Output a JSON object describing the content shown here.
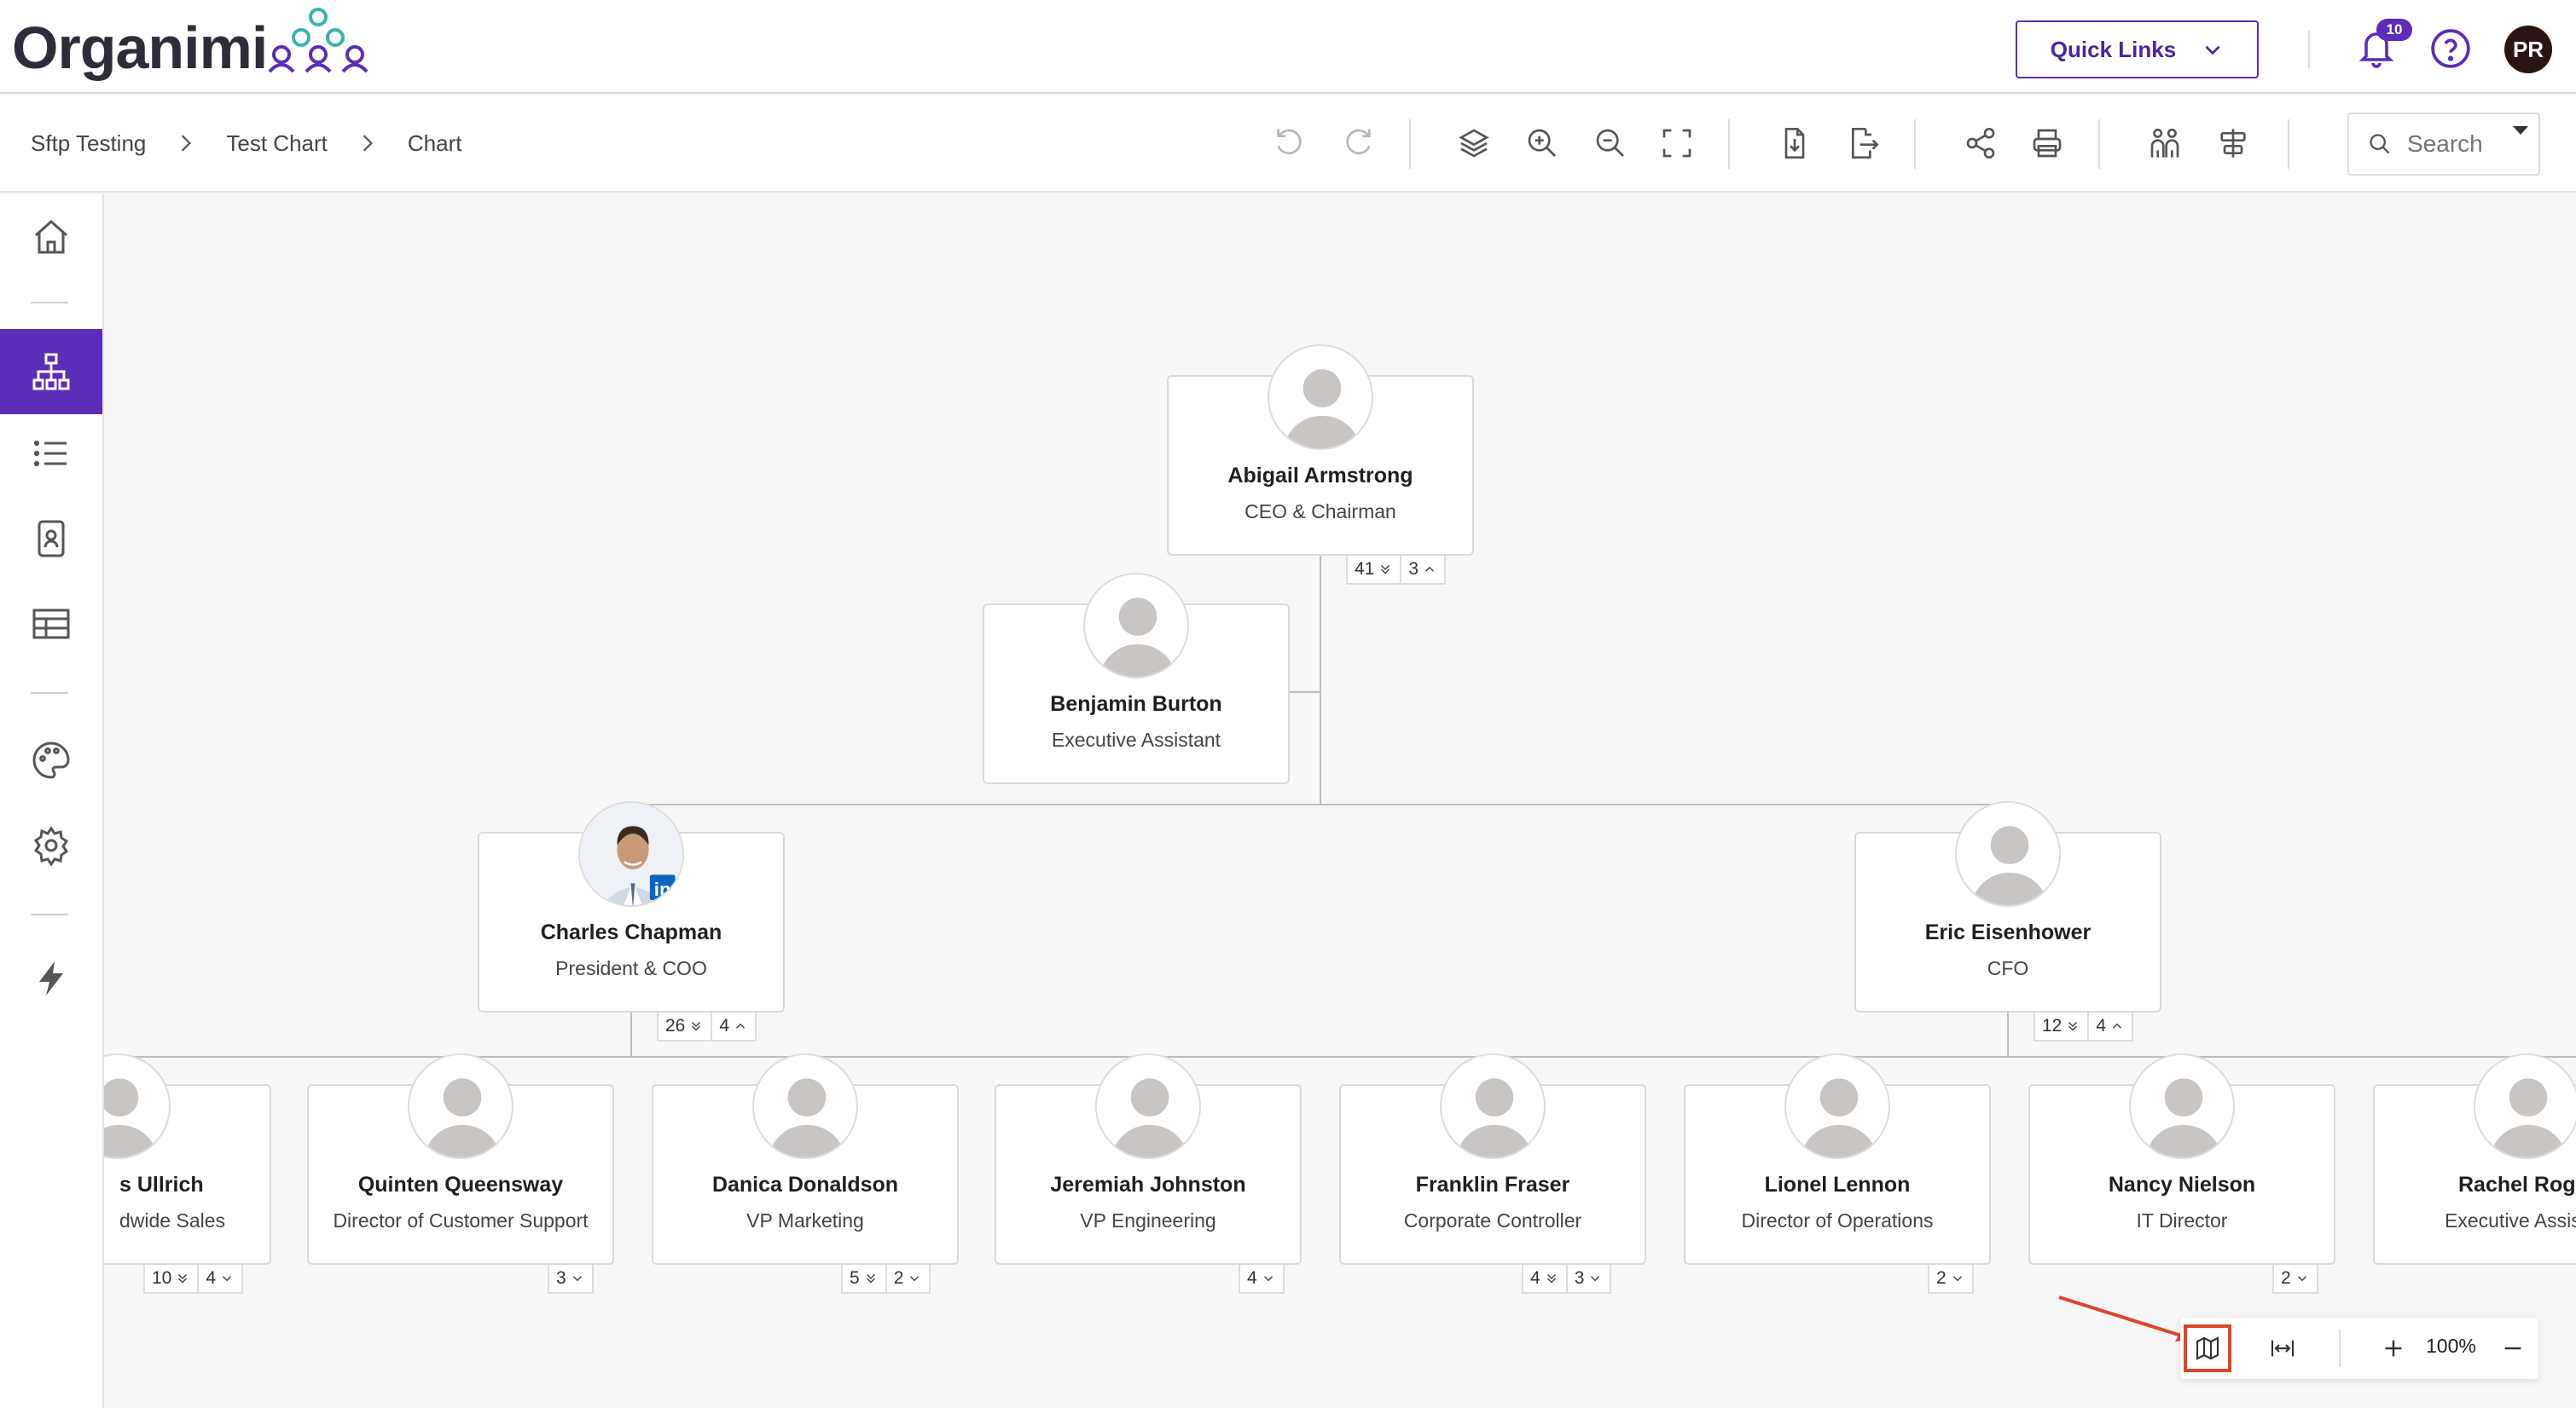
{
  "app": {
    "logo_text": "Organimi"
  },
  "header": {
    "quick_links_label": "Quick Links",
    "notification_count": "10",
    "user_initials": "PR"
  },
  "breadcrumbs": [
    "Sftp Testing",
    "Test Chart",
    "Chart"
  ],
  "search": {
    "placeholder": "Search"
  },
  "toolbar_icons": [
    "undo-icon",
    "redo-icon",
    "layers-icon",
    "zoom-in-icon",
    "zoom-out-icon",
    "fullscreen-icon",
    "import-icon",
    "export-icon",
    "share-icon",
    "print-icon",
    "people-icon",
    "align-icon"
  ],
  "nav_icons": [
    "home-icon",
    "org-chart-icon",
    "list-icon",
    "directory-icon",
    "table-icon",
    "palette-icon",
    "settings-icon",
    "lightning-icon"
  ],
  "colors": {
    "accent": "#5b2db8",
    "highlight": "#e0442c"
  },
  "chart": {
    "ceo": {
      "name": "Abigail Armstrong",
      "title": "CEO & Chairman",
      "pills": [
        "41",
        "3"
      ]
    },
    "assistant": {
      "name": "Benjamin Burton",
      "title": "Executive Assistant"
    },
    "level2": [
      {
        "name": "Charles Chapman",
        "title": "President & COO",
        "pills": [
          "26",
          "4"
        ],
        "photo": "linkedin"
      },
      {
        "name": "Eric Eisenhower",
        "title": "CFO",
        "pills": [
          "12",
          "4"
        ]
      }
    ],
    "level3": [
      {
        "name": "s Ullrich",
        "title": "dwide Sales",
        "pills": [
          "10",
          "4"
        ]
      },
      {
        "name": "Quinten Queensway",
        "title": "Director of Customer Support",
        "pills": [
          "3"
        ]
      },
      {
        "name": "Danica Donaldson",
        "title": "VP Marketing",
        "pills": [
          "5",
          "2"
        ]
      },
      {
        "name": "Jeremiah Johnston",
        "title": "VP Engineering",
        "pills": [
          "4"
        ]
      },
      {
        "name": "Franklin Fraser",
        "title": "Corporate Controller",
        "pills": [
          "4",
          "3"
        ]
      },
      {
        "name": "Lionel Lennon",
        "title": "Director of Operations",
        "pills": [
          "2"
        ]
      },
      {
        "name": "Nancy Nielson",
        "title": "IT Director",
        "pills": [
          "2"
        ]
      },
      {
        "name": "Rachel Roge",
        "title": "Executive Assis",
        "pills": []
      }
    ]
  },
  "bottom_controls": {
    "zoom": "100%"
  }
}
